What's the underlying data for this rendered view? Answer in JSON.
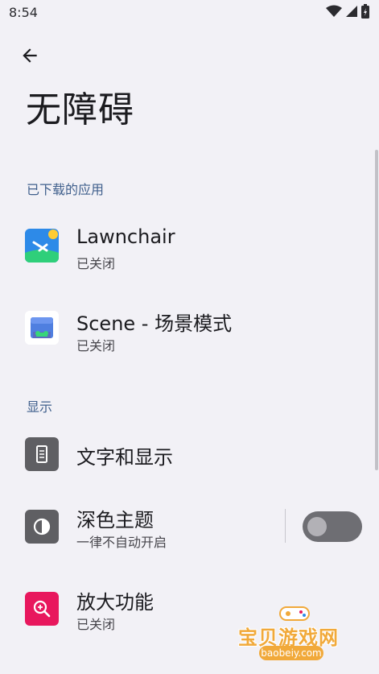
{
  "status_bar": {
    "time": "8:54"
  },
  "header": {
    "title": "无障碍"
  },
  "sections": {
    "downloaded": {
      "header": "已下载的应用",
      "items": [
        {
          "title": "Lawnchair",
          "subtitle": "已关闭",
          "icon": "lawnchair-app-icon"
        },
        {
          "title": "Scene - 场景模式",
          "subtitle": "已关闭",
          "icon": "scene-app-icon"
        }
      ]
    },
    "display": {
      "header": "显示",
      "items": [
        {
          "title": "文字和显示",
          "icon": "text-display-icon"
        },
        {
          "title": "深色主题",
          "subtitle": "一律不自动开启",
          "icon": "dark-theme-icon",
          "toggle_on": false
        },
        {
          "title": "放大功能",
          "subtitle": "已关闭",
          "icon": "magnification-icon"
        }
      ]
    }
  },
  "watermark": {
    "text": "宝贝游戏网",
    "url": "baobeiy.com"
  },
  "colors": {
    "accent": "#3f5f8c",
    "background": "#f2f1f6",
    "icon_gray": "#5f5f63",
    "magnify_pink": "#e8175d"
  }
}
